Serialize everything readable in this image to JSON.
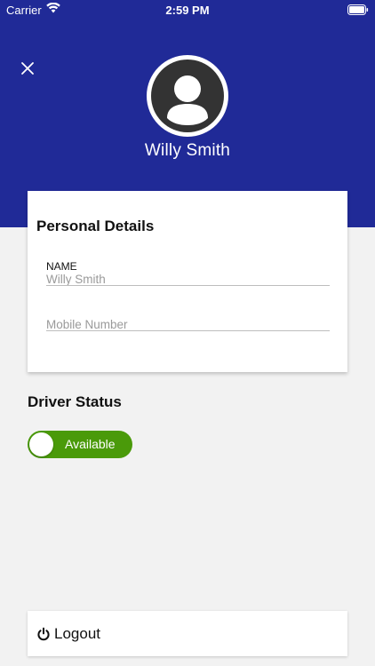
{
  "status_bar": {
    "carrier": "Carrier",
    "time": "2:59 PM",
    "wifi_icon": "wifi-icon",
    "battery_icon": "battery-icon"
  },
  "colors": {
    "header_bg": "#202a97",
    "toggle_on": "#4a9a0a",
    "background": "#f2f2f2"
  },
  "header": {
    "close_icon": "close-icon",
    "avatar_icon": "user-avatar-icon",
    "name": "Willy Smith"
  },
  "personal_details": {
    "title": "Personal Details",
    "name_label": "NAME",
    "name_value": "Willy Smith",
    "mobile_placeholder": "Mobile Number",
    "mobile_value": ""
  },
  "driver_status": {
    "title": "Driver Status",
    "toggle_label": "Available",
    "is_on": true
  },
  "logout": {
    "icon": "power-icon",
    "label": "Logout"
  }
}
